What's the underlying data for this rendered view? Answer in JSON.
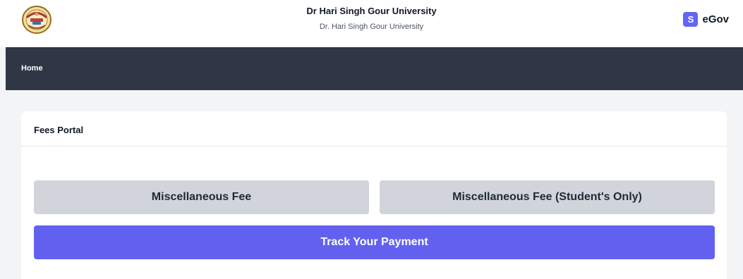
{
  "header": {
    "university_title": "Dr Hari Singh Gour University",
    "university_subtitle": "Dr. Hari Singh Gour University",
    "logo_icon": "university-seal-icon",
    "brand_badge": "S",
    "brand_name": "eGov"
  },
  "nav": {
    "home_label": "Home"
  },
  "card": {
    "title": "Fees Portal",
    "buttons": {
      "misc_fee": "Miscellaneous Fee",
      "misc_fee_students": "Miscellaneous Fee (Student's Only)",
      "track_payment": "Track Your Payment"
    }
  },
  "colors": {
    "nav_bg": "#2f3746",
    "accent": "#6261ef",
    "button_gray": "#d1d5db",
    "page_bg": "#f3f4f6"
  }
}
